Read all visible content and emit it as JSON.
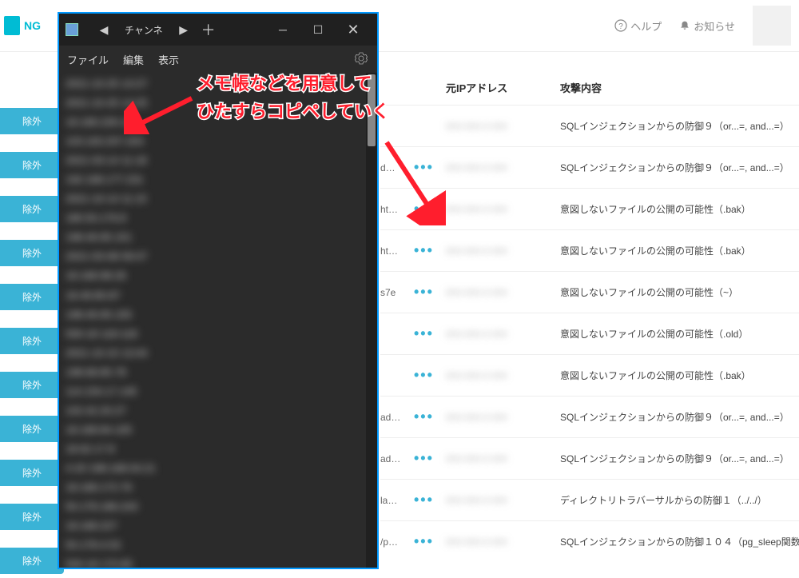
{
  "logo_text": "NG",
  "header": {
    "help": "ヘルプ",
    "notice": "お知らせ"
  },
  "exclude_label": "除外",
  "table": {
    "col_ip": "元IPアドレス",
    "col_attack": "攻撃内容",
    "rows": [
      {
        "url": "",
        "ip": "",
        "attack": "SQLインジェクションからの防御９（or...=, and...=）",
        "has_menu": false
      },
      {
        "url": "d…",
        "ip": "",
        "attack": "SQLインジェクションからの防御９（or...=, and...=）",
        "has_menu": true
      },
      {
        "url": "ht…",
        "ip": "",
        "attack": "意図しないファイルの公開の可能性（.bak）",
        "has_menu": true
      },
      {
        "url": "ht…",
        "ip": "",
        "attack": "意図しないファイルの公開の可能性（.bak）",
        "has_menu": true
      },
      {
        "url": "s7e",
        "ip": "",
        "attack": "意図しないファイルの公開の可能性（~）",
        "has_menu": true
      },
      {
        "url": "",
        "ip": "",
        "attack": "意図しないファイルの公開の可能性（.old）",
        "has_menu": true
      },
      {
        "url": "",
        "ip": "",
        "attack": "意図しないファイルの公開の可能性（.bak）",
        "has_menu": true
      },
      {
        "url": "ad…",
        "ip": "",
        "attack": "SQLインジェクションからの防御９（or...=, and...=）",
        "has_menu": true
      },
      {
        "url": "ad…",
        "ip": "",
        "attack": "SQLインジェクションからの防御９（or...=, and...=）",
        "has_menu": true
      },
      {
        "url": "la…",
        "ip": "",
        "attack": "ディレクトリトラバーサルからの防御１（../../）",
        "has_menu": true
      },
      {
        "url": "/p…",
        "ip": "",
        "attack": "SQLインジェクションからの防御１０４（pg_sleep関数",
        "has_menu": true
      }
    ]
  },
  "notepad": {
    "tab": "チャンネ",
    "menus": [
      "ファイル",
      "編集",
      "表示"
    ],
    "lines": [
      "2021-10-25 14:27",
      "2021-10-25 14:25",
      "18.168.228.10",
      "103.163.207.203",
      "2021-03-14 11:18",
      "192.168.177.231",
      "2021-10-14 11:15",
      "180.50.176.8",
      "198.49.95.151",
      "2021-03-08 09:47",
      "18.168.98.26",
      "18.49.80.87",
      "198.49.95.155",
      "500-18 118-118",
      "2021-10-15 13:44",
      "198.68.85.78",
      "114.154.17.145",
      "102.42.20.27",
      "18.168.84.105",
      "18.62.17.8",
      "4-20 198.168.04.21",
      "18.168.172.76",
      "50.178.186.243",
      "18.168.227",
      "50.178.4.53",
      "500-18 170.85"
    ]
  },
  "annotation": {
    "line1": "メモ帳などを用意して",
    "line2": "ひたすらコピペしていく"
  },
  "exclude_count": 11
}
